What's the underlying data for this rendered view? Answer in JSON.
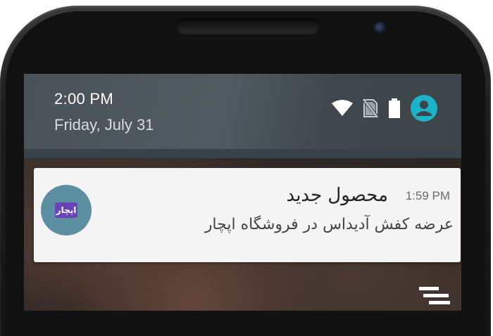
{
  "status_bar": {
    "time": "2:00 PM",
    "date": "Friday, July 31",
    "icons": [
      "wifi-icon",
      "no-sim-icon",
      "battery-icon",
      "user-account-icon"
    ],
    "account_color": "#1ab3c9"
  },
  "notification": {
    "app_icon_label": "اپچار",
    "app_icon_color": "#5d8fa3",
    "time": "1:59 PM",
    "title": "محصول جدید",
    "text": "عرضه کفش آدیداس در فروشگاه اپچار"
  }
}
